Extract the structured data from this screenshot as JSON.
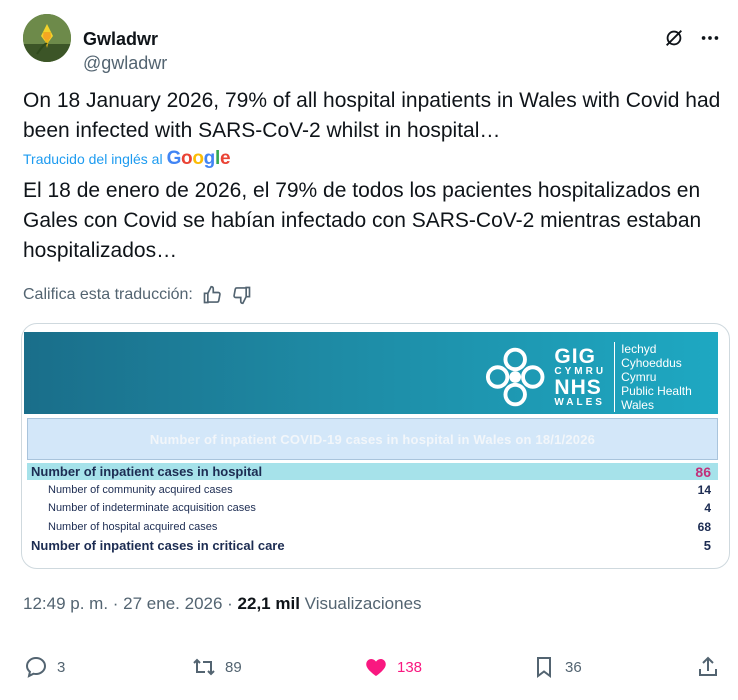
{
  "author": {
    "name": "Gwladwr",
    "handle": "@gwladwr"
  },
  "tweet": {
    "text": "On 18 January 2026, 79% of all hospital inpatients in Wales with Covid had been infected with SARS-CoV-2 whilst in hospital…",
    "translated_by_label": "Traducido del inglés al",
    "translator_brand": "Google",
    "translated_text": "El 18 de enero de 2026, el 79% de todos los pacientes hospitalizados en Gales con Covid se habían infectado con SARS-CoV-2 mientras estaban hospitalizados…",
    "rate_label": "Califica esta traducción:"
  },
  "media": {
    "logo_gig": "GIG",
    "logo_cymru": "CYMRU",
    "logo_nhs": "NHS",
    "logo_wales": "WALES",
    "org_line_1": "Iechyd Cyhoeddus",
    "org_line_2": "Cymru",
    "org_line_3": "Public Health",
    "org_line_4": "Wales",
    "table_title": "Number of inpatient COVID-19 cases in hospital in Wales on 18/1/2026",
    "rows": [
      {
        "label": "Number of inpatient cases in hospital",
        "value": "86"
      },
      {
        "label": "Number of community acquired cases",
        "value": "14"
      },
      {
        "label": "Number of indeterminate acquisition cases",
        "value": "4"
      },
      {
        "label": "Number of hospital acquired cases",
        "value": "68"
      },
      {
        "label": "Number of inpatient cases in critical care",
        "value": "5"
      }
    ]
  },
  "meta": {
    "time": "12:49 p. m.",
    "separator": " · ",
    "date": "27 ene. 2026",
    "views_count": "22,1 mil",
    "views_label": "Visualizaciones"
  },
  "actions": {
    "replies": "3",
    "reposts": "89",
    "likes": "138",
    "bookmarks": "36"
  },
  "colors": {
    "accent": "#1d9bf0",
    "like": "#f91880",
    "banner": "#1e8ba5",
    "highlight_row": "#a6e2ea"
  }
}
